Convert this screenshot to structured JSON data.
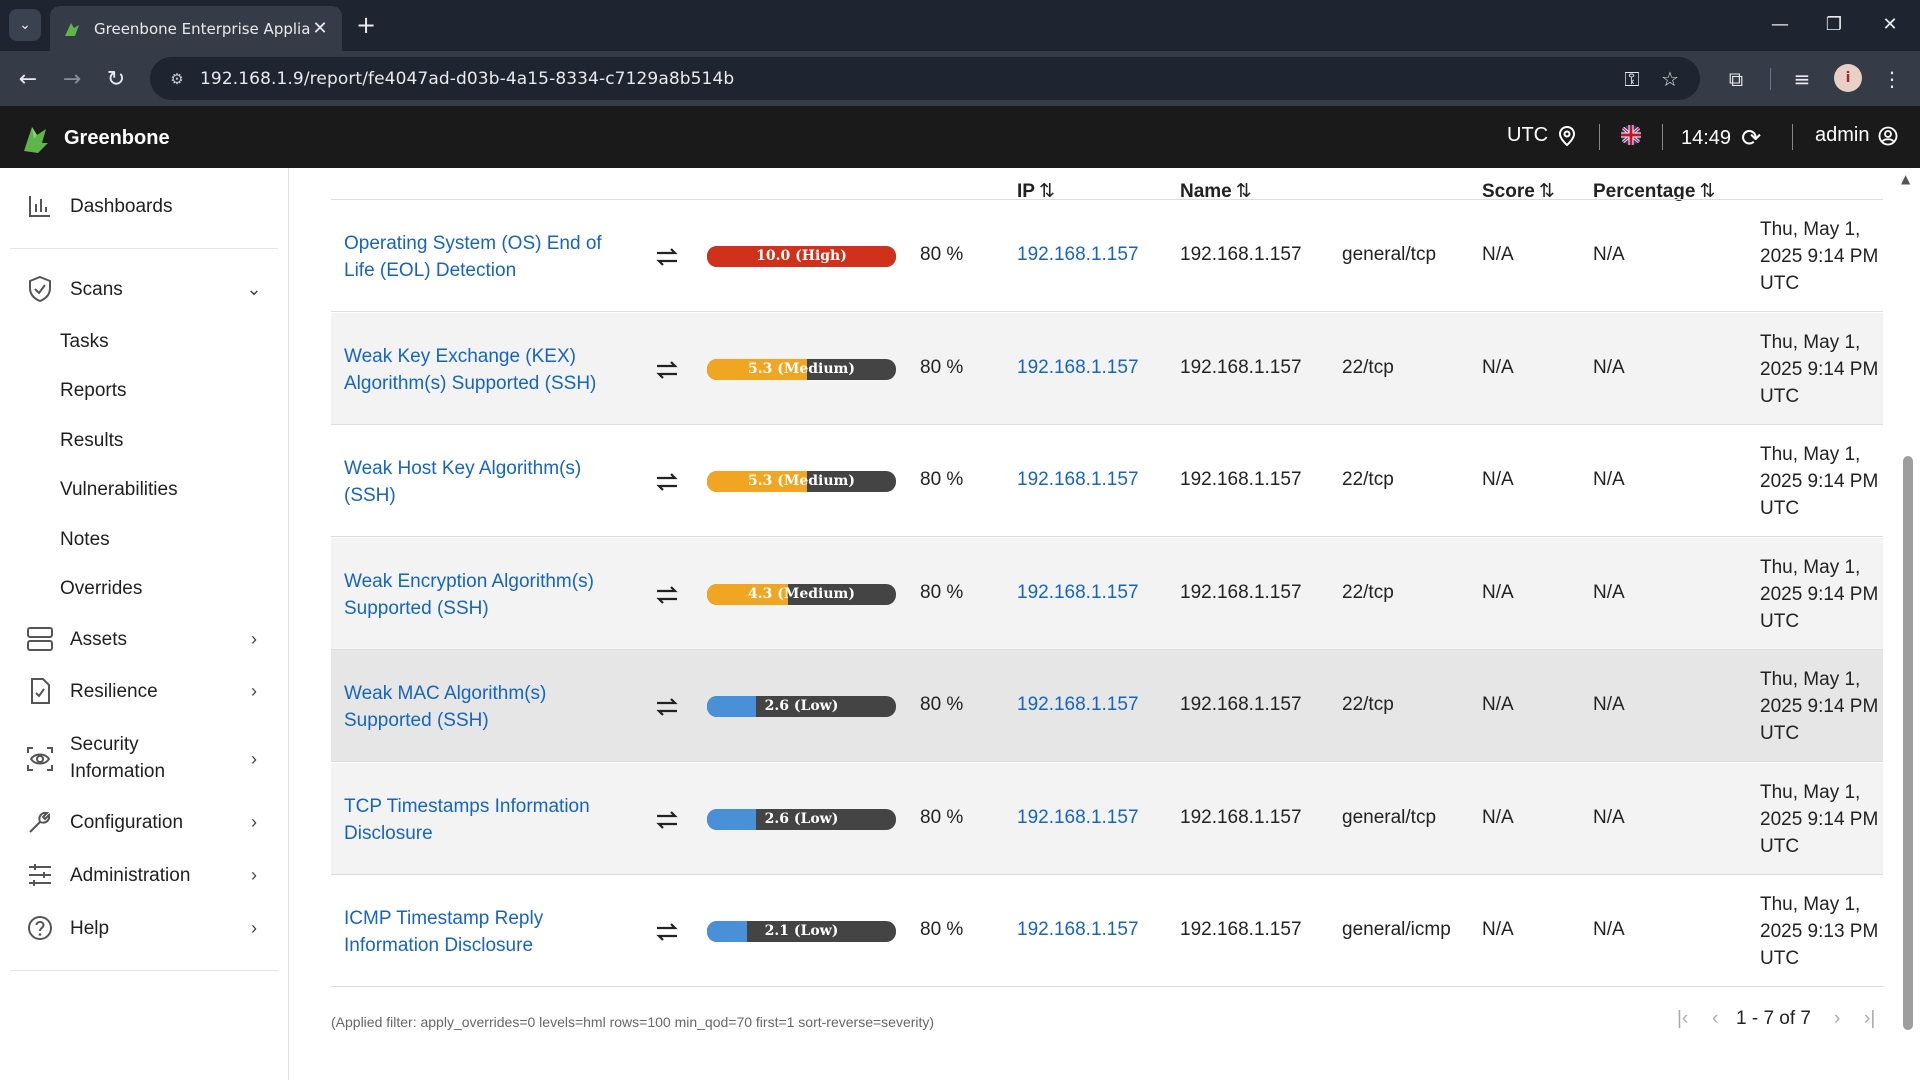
{
  "browser": {
    "tab_title": "Greenbone Enterprise Applianc",
    "tab_close": "✕",
    "new_tab": "+",
    "url": "192.168.1.9/report/fe4047ad-d03b-4a15-8334-c7129a8b514b"
  },
  "header": {
    "brand": "Greenbone",
    "timezone": "UTC",
    "time": "14:49",
    "user": "admin"
  },
  "sidebar": {
    "dashboards": "Dashboards",
    "scans": "Scans",
    "scans_sub": [
      "Tasks",
      "Reports",
      "Results",
      "Vulnerabilities",
      "Notes",
      "Overrides"
    ],
    "assets": "Assets",
    "resilience": "Resilience",
    "security_info_1": "Security",
    "security_info_2": "Information",
    "configuration": "Configuration",
    "administration": "Administration",
    "help": "Help"
  },
  "table": {
    "headers": {
      "ip": "IP",
      "name": "Name",
      "score": "Score",
      "percentage": "Percentage"
    },
    "rows": [
      {
        "vuln": "Operating System (OS) End of Life (EOL) Detection",
        "severity_label": "10.0 (High)",
        "severity": 10.0,
        "qod": "80 %",
        "ip": "192.168.1.157",
        "name": "192.168.1.157",
        "location": "general/tcp",
        "score": "N/A",
        "percentage": "N/A",
        "created": "Thu, May 1, 2025 9:14 PM UTC"
      },
      {
        "vuln": "Weak Key Exchange (KEX) Algorithm(s) Supported (SSH)",
        "severity_label": "5.3 (Medium)",
        "severity": 5.3,
        "qod": "80 %",
        "ip": "192.168.1.157",
        "name": "192.168.1.157",
        "location": "22/tcp",
        "score": "N/A",
        "percentage": "N/A",
        "created": "Thu, May 1, 2025 9:14 PM UTC"
      },
      {
        "vuln": "Weak Host Key Algorithm(s) (SSH)",
        "severity_label": "5.3 (Medium)",
        "severity": 5.3,
        "qod": "80 %",
        "ip": "192.168.1.157",
        "name": "192.168.1.157",
        "location": "22/tcp",
        "score": "N/A",
        "percentage": "N/A",
        "created": "Thu, May 1, 2025 9:14 PM UTC"
      },
      {
        "vuln": "Weak Encryption Algorithm(s) Supported (SSH)",
        "severity_label": "4.3 (Medium)",
        "severity": 4.3,
        "qod": "80 %",
        "ip": "192.168.1.157",
        "name": "192.168.1.157",
        "location": "22/tcp",
        "score": "N/A",
        "percentage": "N/A",
        "created": "Thu, May 1, 2025 9:14 PM UTC"
      },
      {
        "vuln": "Weak MAC Algorithm(s) Supported (SSH)",
        "severity_label": "2.6 (Low)",
        "severity": 2.6,
        "qod": "80 %",
        "ip": "192.168.1.157",
        "name": "192.168.1.157",
        "location": "22/tcp",
        "score": "N/A",
        "percentage": "N/A",
        "created": "Thu, May 1, 2025 9:14 PM UTC"
      },
      {
        "vuln": "TCP Timestamps Information Disclosure",
        "severity_label": "2.6 (Low)",
        "severity": 2.6,
        "qod": "80 %",
        "ip": "192.168.1.157",
        "name": "192.168.1.157",
        "location": "general/tcp",
        "score": "N/A",
        "percentage": "N/A",
        "created": "Thu, May 1, 2025 9:14 PM UTC"
      },
      {
        "vuln": "ICMP Timestamp Reply Information Disclosure",
        "severity_label": "2.1 (Low)",
        "severity": 2.1,
        "qod": "80 %",
        "ip": "192.168.1.157",
        "name": "192.168.1.157",
        "location": "general/icmp",
        "score": "N/A",
        "percentage": "N/A",
        "created": "Thu, May 1, 2025 9:13 PM UTC"
      }
    ]
  },
  "footer": {
    "filter": "(Applied filter: apply_overrides=0 levels=hml rows=100 min_qod=70 first=1 sort-reverse=severity)",
    "pagination": "1 - 7 of 7"
  },
  "colors": {
    "high": "#d0311a",
    "medium": "#f0a622",
    "low": "#4a90d9",
    "bar_bg": "#444444",
    "link": "#1565c0"
  }
}
